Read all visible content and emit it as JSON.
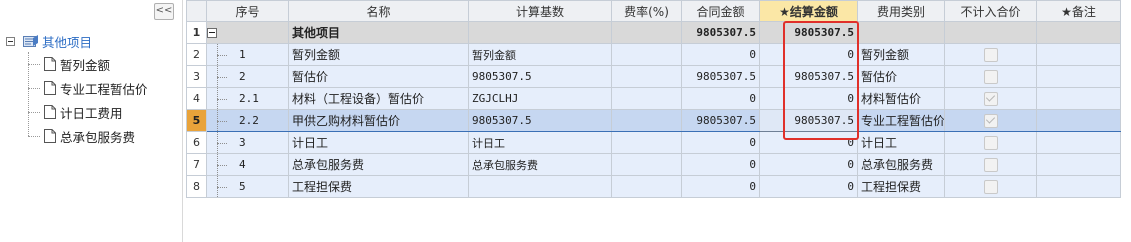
{
  "sidebar": {
    "collapse_label": "<<",
    "root": {
      "label": "其他项目",
      "icon": "folder-tree-icon"
    },
    "items": [
      {
        "label": "暂列金额",
        "icon": "document-icon"
      },
      {
        "label": "专业工程暂估价",
        "icon": "document-icon"
      },
      {
        "label": "计日工费用",
        "icon": "document-icon"
      },
      {
        "label": "总承包服务费",
        "icon": "document-icon"
      }
    ]
  },
  "grid": {
    "headers": {
      "seq": "序号",
      "name": "名称",
      "base": "计算基数",
      "rate": "费率(%)",
      "contract": "合同金额",
      "settle": "★结算金额",
      "category": "费用类别",
      "exclude": "不计入合价",
      "remark": "★备注"
    },
    "group_row": {
      "num": "1",
      "name": "其他项目",
      "contract": "9805307.5",
      "settle": "9805307.5"
    },
    "rows": [
      {
        "num": "2",
        "seq": "1",
        "name": "暂列金额",
        "base": "暂列金额",
        "contract": "0",
        "settle": "0",
        "category": "暂列金额",
        "exclude_checked": false
      },
      {
        "num": "3",
        "seq": "2",
        "name": "暂估价",
        "base": "9805307.5",
        "contract": "9805307.5",
        "settle": "9805307.5",
        "category": "暂估价",
        "exclude_checked": false
      },
      {
        "num": "4",
        "seq": "2.1",
        "name": "材料（工程设备）暂估价",
        "base": "ZGJCLHJ",
        "contract": "0",
        "settle": "0",
        "category": "材料暂估价",
        "exclude_checked": true
      },
      {
        "num": "5",
        "seq": "2.2",
        "name": "甲供乙购材料暂估价",
        "base": "9805307.5",
        "contract": "9805307.5",
        "settle": "9805307.5",
        "category": "专业工程暂估价",
        "exclude_checked": true
      },
      {
        "num": "6",
        "seq": "3",
        "name": "计日工",
        "base": "计日工",
        "contract": "0",
        "settle": "0",
        "category": "计日工",
        "exclude_checked": false
      },
      {
        "num": "7",
        "seq": "4",
        "name": "总承包服务费",
        "base": "总承包服务费",
        "contract": "0",
        "settle": "0",
        "category": "总承包服务费",
        "exclude_checked": false
      },
      {
        "num": "8",
        "seq": "5",
        "name": "工程担保费",
        "base": "",
        "contract": "0",
        "settle": "0",
        "category": "工程担保费",
        "exclude_checked": false
      }
    ],
    "selected_row": "5"
  },
  "colors": {
    "highlight_box": "#e0302a",
    "selected_row": "#c6d7f1",
    "selected_row_num": "#e9a33a",
    "header_star": "#fbe7a6",
    "row_bg": "#e6eefb",
    "group_bg": "#d9d9d9",
    "link_blue": "#2b6cc4"
  }
}
